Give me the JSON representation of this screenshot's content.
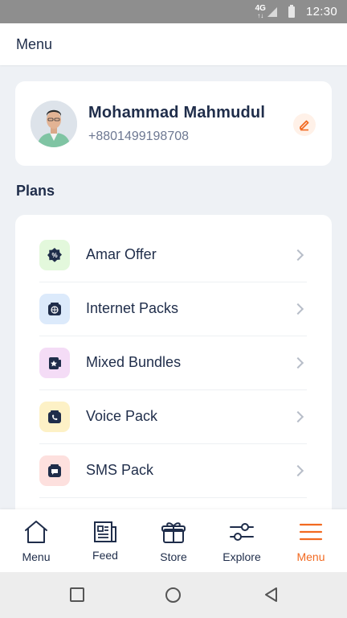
{
  "status_bar": {
    "network": "4G",
    "time": "12:30"
  },
  "header": {
    "title": "Menu"
  },
  "profile": {
    "name": "Mohammad Mahmudul",
    "phone": "+8801499198708"
  },
  "plans": {
    "title": "Plans",
    "items": [
      {
        "label": "Amar Offer",
        "icon": "offer-icon",
        "bg": "#e3f8dc"
      },
      {
        "label": "Internet Packs",
        "icon": "internet-icon",
        "bg": "#dceafb"
      },
      {
        "label": "Mixed Bundles",
        "icon": "bundle-icon",
        "bg": "#f4dcf6"
      },
      {
        "label": "Voice Pack",
        "icon": "voice-icon",
        "bg": "#fdf1c6"
      },
      {
        "label": "SMS Pack",
        "icon": "sms-icon",
        "bg": "#fde0de"
      }
    ]
  },
  "bottom_nav": {
    "items": [
      {
        "label": "Menu",
        "icon": "home-icon"
      },
      {
        "label": "Feed",
        "icon": "feed-icon"
      },
      {
        "label": "Store",
        "icon": "store-gift-icon"
      },
      {
        "label": "Explore",
        "icon": "explore-sliders-icon"
      },
      {
        "label": "Menu",
        "icon": "menu-hamburger-icon",
        "active": true
      }
    ],
    "active_color": "#f26a21"
  }
}
